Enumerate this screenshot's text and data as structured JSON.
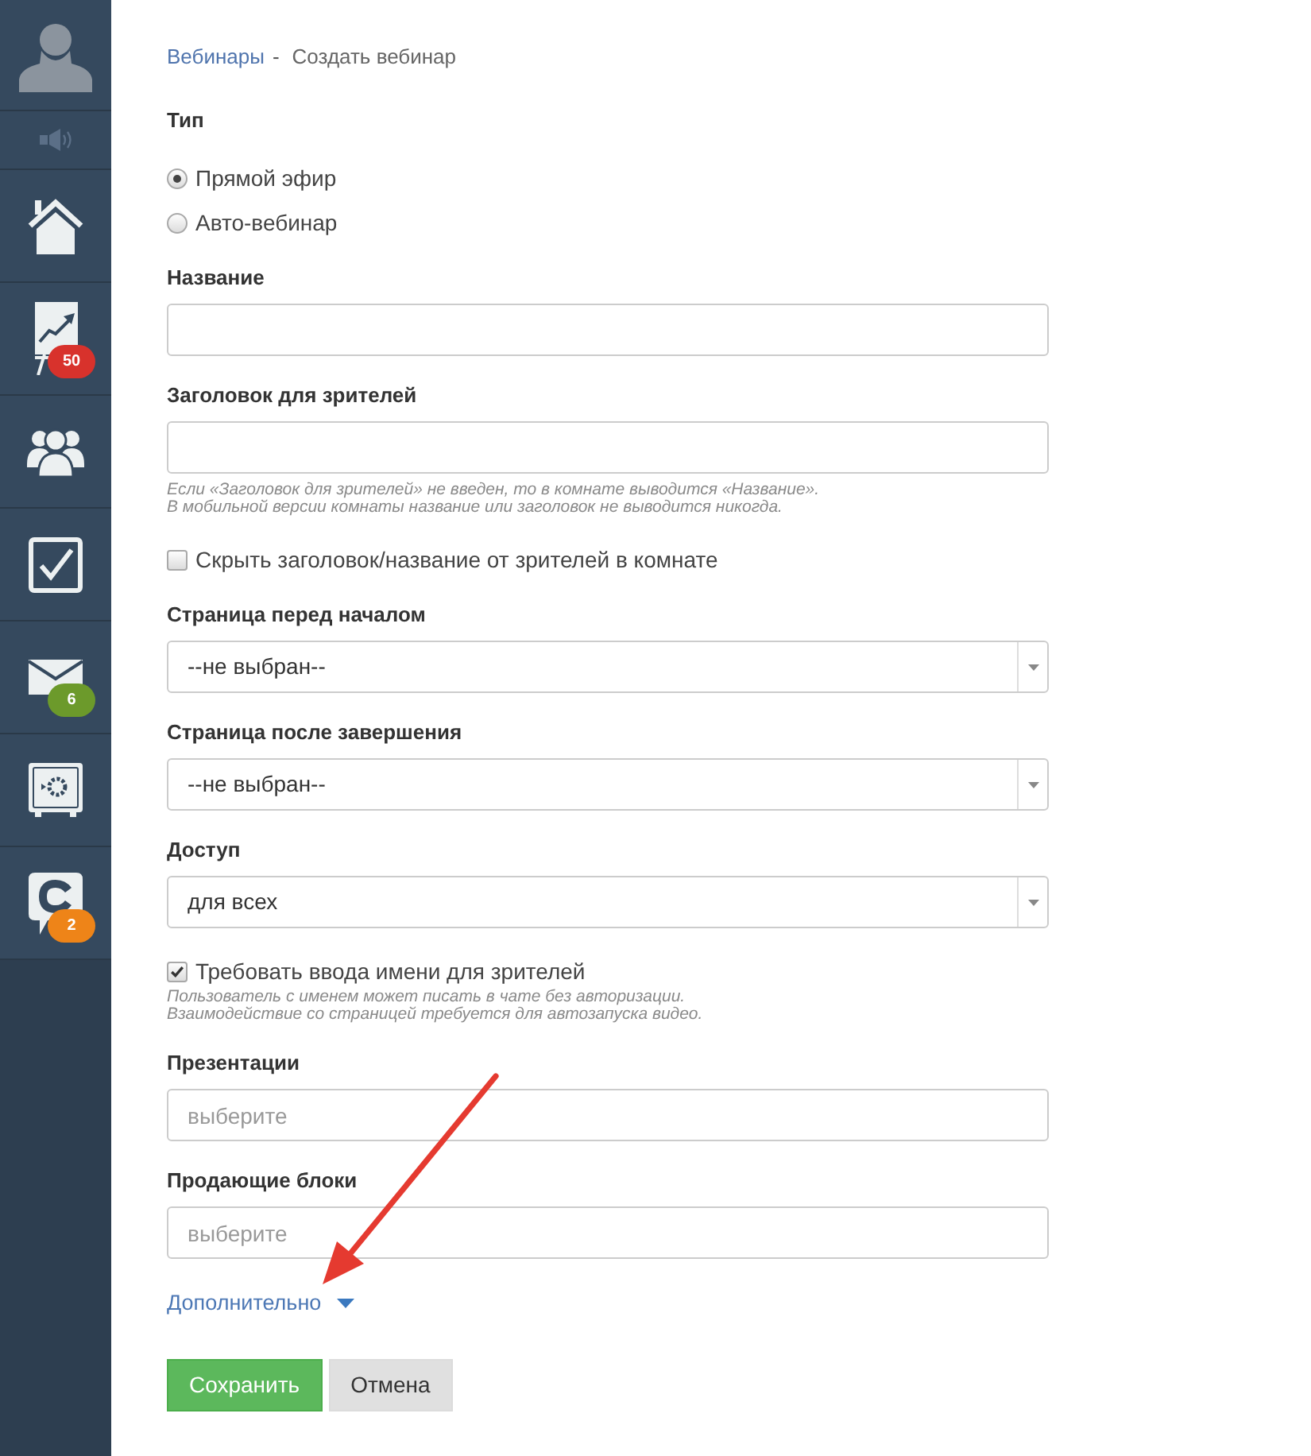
{
  "sidebar": {
    "items": [
      {
        "kind": "avatar"
      },
      {
        "kind": "sound"
      },
      {
        "kind": "home"
      },
      {
        "kind": "chart",
        "badge": {
          "text": "50",
          "color": "#d8322c"
        }
      },
      {
        "kind": "users"
      },
      {
        "kind": "tasks"
      },
      {
        "kind": "mail",
        "badge": {
          "text": "6",
          "color": "#6c9a2b"
        }
      },
      {
        "kind": "safe"
      },
      {
        "kind": "chat",
        "badge": {
          "text": "2",
          "color": "#ee8418"
        }
      }
    ]
  },
  "breadcrumb": {
    "items": [
      {
        "label": "Вебинары",
        "kind": "link"
      },
      {
        "label": "-",
        "kind": "separator"
      },
      {
        "label": "Создать вебинар",
        "kind": "current"
      }
    ]
  },
  "form": {
    "fields": [
      {
        "kind": "radio",
        "label": "Тип",
        "options": [
          {
            "label": "Прямой эфир",
            "selected": true
          },
          {
            "label": "Авто-вебинар",
            "selected": false
          }
        ]
      },
      {
        "kind": "text",
        "label": "Название"
      },
      {
        "kind": "text",
        "label": "Заголовок для зрителей",
        "help": [
          "Если «Заголовок для зрителей» не введен, то в комнате выводится «Название».",
          "В мобильной версии комнаты название или заголовок не выводится никогда."
        ]
      },
      {
        "kind": "checkbox",
        "label": "Скрыть заголовок/название от зрителей в комнате",
        "checked": false
      },
      {
        "kind": "select",
        "label": "Страница перед началом",
        "value": "--не выбран--"
      },
      {
        "kind": "select",
        "label": "Страница после завершения",
        "value": "--не выбран--"
      },
      {
        "kind": "select",
        "label": "Доступ",
        "value": "для всех"
      },
      {
        "kind": "checkbox",
        "label": "Требовать ввода имени для зрителей",
        "checked": true,
        "help": [
          "Пользователь с именем может писать в чате без авторизации.",
          "Взаимодействие со страницей требуется для автозапуска видео."
        ]
      },
      {
        "kind": "text",
        "label": "Презентации",
        "placeholder": "выберите"
      },
      {
        "kind": "text",
        "label": "Продающие блоки",
        "placeholder": "выберите"
      }
    ],
    "more_link": {
      "label": "Дополнительно",
      "expanded": false
    },
    "buttons": [
      {
        "label": "Сохранить",
        "kind": "primary"
      },
      {
        "label": "Отмена",
        "kind": "secondary"
      }
    ]
  }
}
